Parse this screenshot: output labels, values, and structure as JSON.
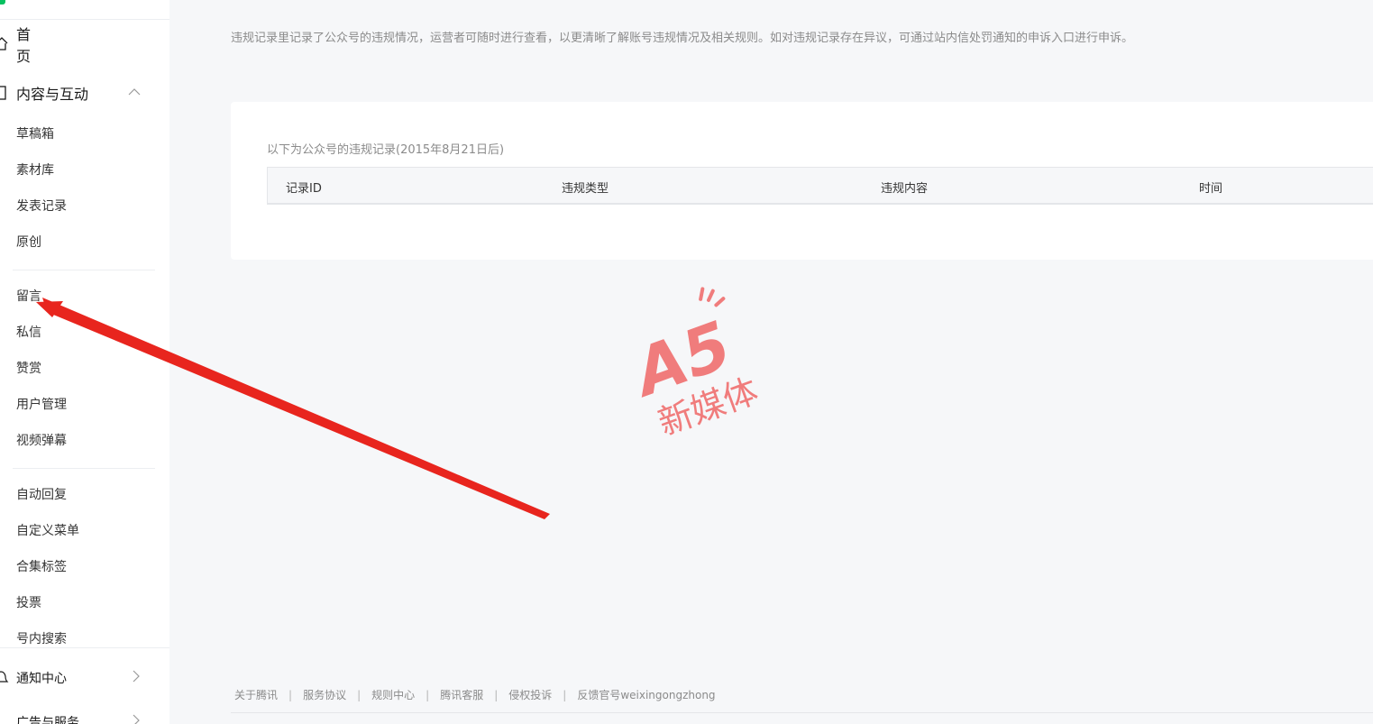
{
  "sidebar": {
    "home_label": "首页",
    "group_label": "内容与互动",
    "items_a": [
      "草稿箱",
      "素材库",
      "发表记录",
      "原创"
    ],
    "items_b": [
      "留言",
      "私信",
      "赞赏",
      "用户管理",
      "视频弹幕"
    ],
    "items_c": [
      "自动回复",
      "自定义菜单",
      "合集标签",
      "投票",
      "号内搜索"
    ],
    "notice_label": "通知中心",
    "last_label": "广告与服务"
  },
  "main": {
    "intro": "违规记录里记录了公众号的违规情况，运营者可随时进行查看，以更清晰了解账号违规情况及相关规则。如对违规记录存在异议，可通过站内信处罚通知的申诉入口进行申诉。",
    "caption": "以下为公众号的违规记录(2015年8月21日后)",
    "columns": [
      "记录ID",
      "违规类型",
      "违规内容",
      "时间"
    ]
  },
  "watermark": {
    "brand": "A5",
    "text": "新媒体",
    "color": "#f07c7c"
  },
  "annotation": {
    "color": "#e8251e"
  },
  "footer": {
    "links": [
      "关于腾讯",
      "服务协议",
      "规则中心",
      "腾讯客服",
      "侵权投诉",
      "反馈官号weixingongzhong"
    ]
  },
  "colors": {
    "brand_green": "#07c160",
    "page_bg": "#f6f7f9"
  }
}
